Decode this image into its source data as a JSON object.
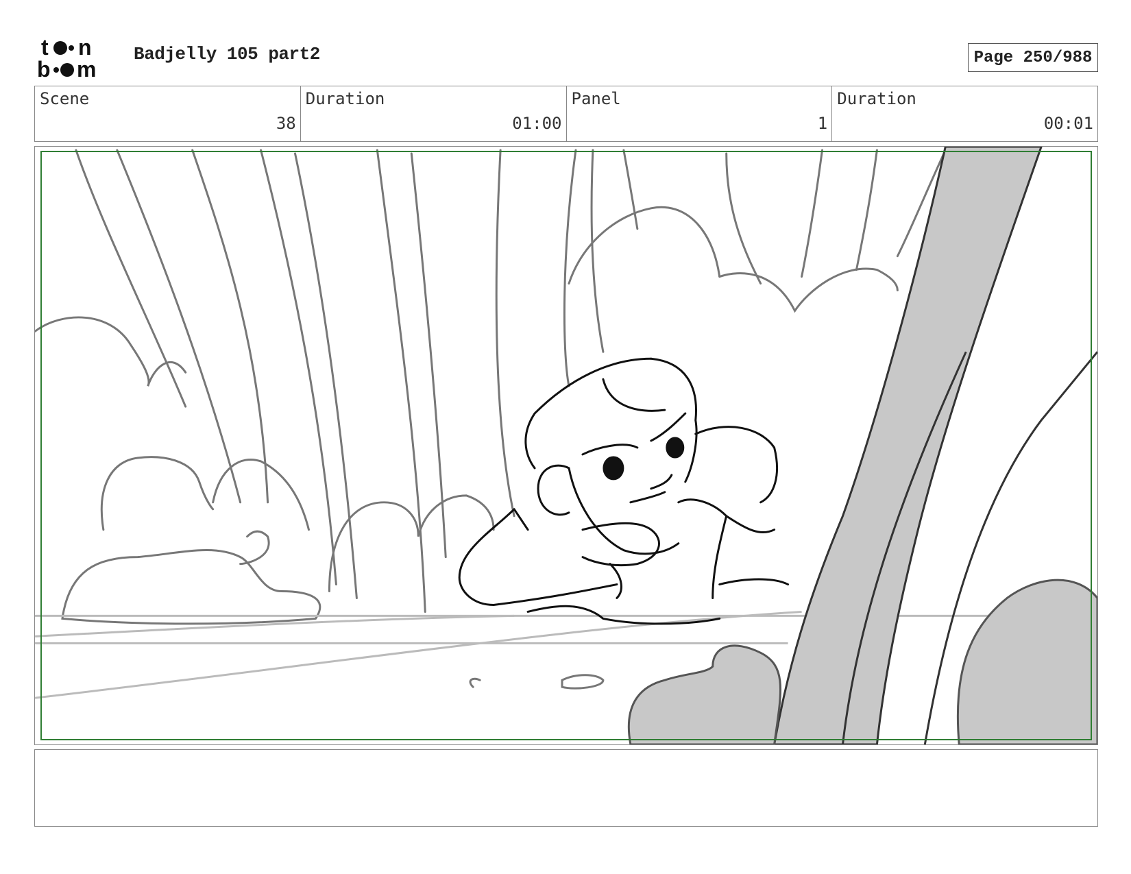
{
  "header": {
    "logo_text": "toon boom",
    "project_title": "Badjelly 105 part2",
    "page_label": "Page 250/988"
  },
  "info": {
    "scene_label": "Scene",
    "scene_value": "38",
    "scene_duration_label": "Duration",
    "scene_duration_value": "01:00",
    "panel_label": "Panel",
    "panel_value": "1",
    "panel_duration_label": "Duration",
    "panel_duration_value": "00:01"
  },
  "panel": {
    "safe_frame_color": "#2e7d32",
    "sketch_gray": "#777777",
    "ink_color": "#111111",
    "tree_fill": "#c8c8c8"
  },
  "notes": {
    "text": ""
  }
}
